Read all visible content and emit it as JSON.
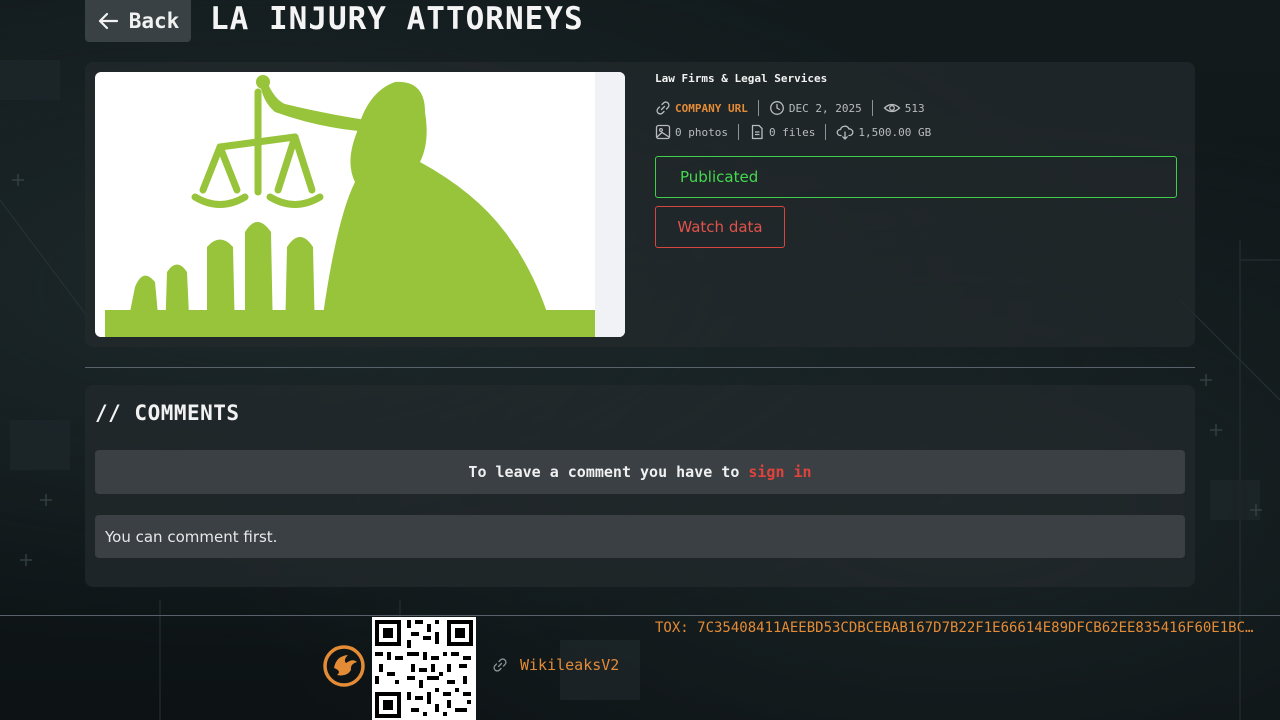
{
  "header": {
    "back_label": "Back",
    "title": "LA INJURY ATTORNEYS"
  },
  "post": {
    "category": "Law Firms & Legal Services",
    "company_url_label": "COMPANY URL",
    "date": "DEC 2, 2025",
    "views": "513",
    "photos": "0 photos",
    "files": "0 files",
    "size": "1,500.00 GB",
    "status": "Publicated",
    "watch_label": "Watch data"
  },
  "comments": {
    "title": "// COMMENTS",
    "signin_prefix": "To leave a comment you have to",
    "signin_link": "sign in",
    "empty": "You can comment first."
  },
  "footer": {
    "link_label": "WikileaksV2",
    "tox": "TOX: 7C35408411AEEBD53CDBCEBAB167D7B22F1E66614E89DFCB62EE835416F60E1BC…"
  },
  "colors": {
    "accent_orange": "#e48b36",
    "status_green": "#45d84f",
    "danger_red": "#e0433c",
    "logo_green": "#97c43a"
  }
}
